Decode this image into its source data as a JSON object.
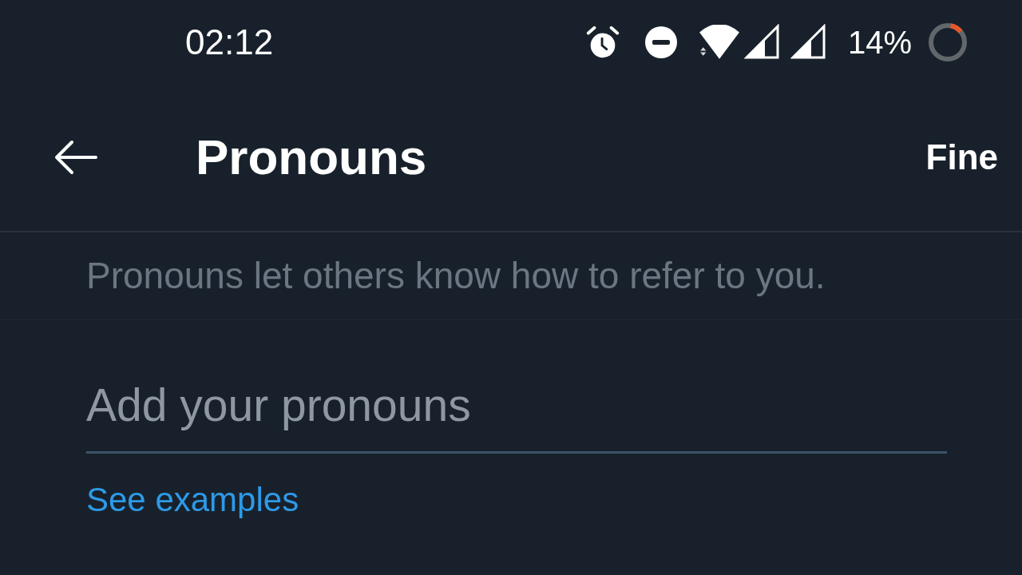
{
  "status_bar": {
    "time": "02:12",
    "battery_percent": "14%"
  },
  "header": {
    "title": "Pronouns",
    "action": "Fine"
  },
  "description": "Pronouns let others know how to refer to you.",
  "pronouns_field": {
    "placeholder": "Add your pronouns"
  },
  "examples_link": "See examples"
}
